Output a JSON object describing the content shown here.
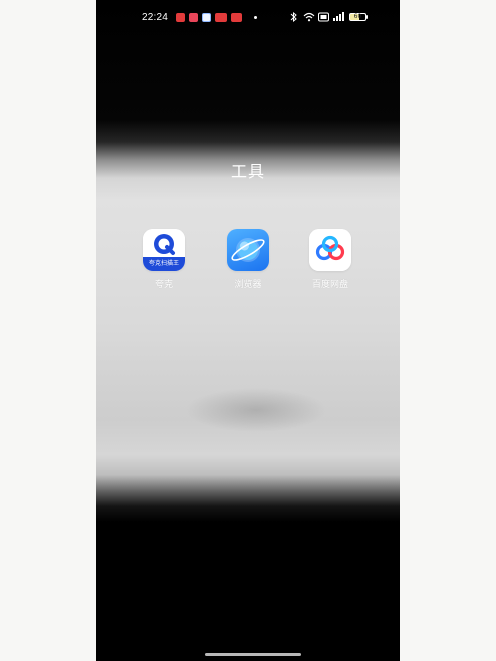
{
  "status_bar": {
    "time": "22:24",
    "battery_level": "60",
    "notifications": [
      {
        "icon": "red-app-icon",
        "color": "#e23b3b"
      },
      {
        "icon": "red-app-icon",
        "color": "#e9465a"
      },
      {
        "icon": "blue-app-icon",
        "color": "#8fb8ff"
      },
      {
        "icon": "red-app-icon",
        "color": "#e23b3b"
      },
      {
        "icon": "red-app-icon",
        "color": "#e23b3b"
      }
    ],
    "system_icons": [
      "bluetooth-icon",
      "wifi-icon",
      "hd-icon",
      "signal-icon",
      "battery-icon"
    ]
  },
  "folder": {
    "title": "工具"
  },
  "apps": [
    {
      "name": "quark-app",
      "label": "夸克",
      "badge_text": "夸克扫描王",
      "icon": "quark-icon",
      "color": "#1e4bd8"
    },
    {
      "name": "browser-app",
      "label": "浏览器",
      "icon": "planet-browser-icon",
      "color": "#2f8cff"
    },
    {
      "name": "baidu-netdisk-app",
      "label": "百度网盘",
      "icon": "baidu-cloud-icon",
      "color": "#2f7bff"
    }
  ],
  "colors": {
    "accent_blue": "#2f8cff",
    "text_white": "#ffffff",
    "background_black": "#000000"
  }
}
